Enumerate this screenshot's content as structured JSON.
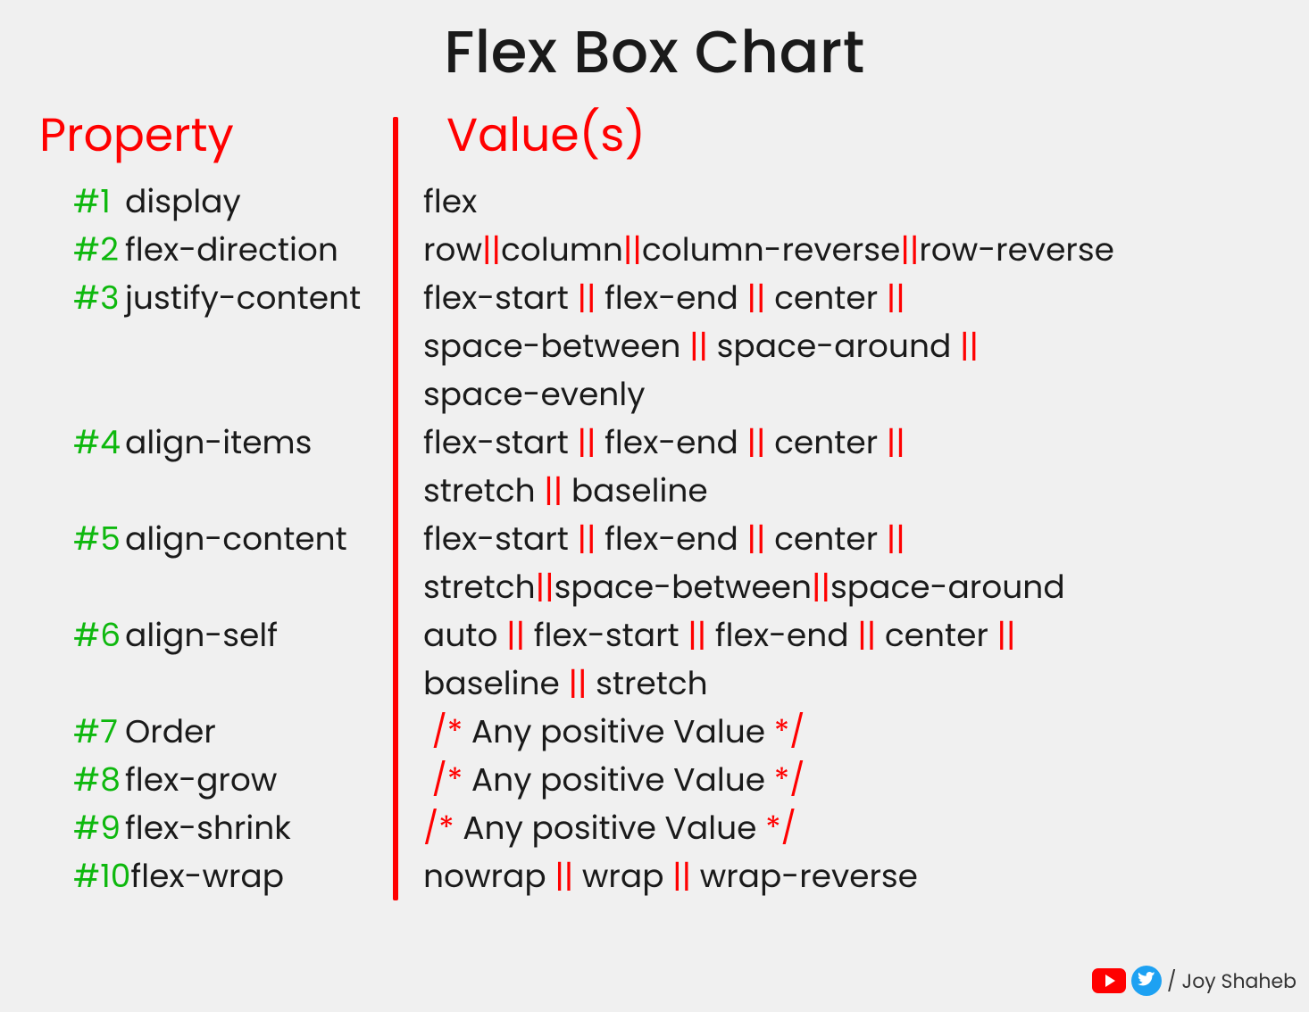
{
  "title": "Flex Box Chart",
  "headers": {
    "property": "Property",
    "values": "Value(s)"
  },
  "separator": "||",
  "rows": [
    {
      "idx": "#1",
      "prop": "display",
      "values": [
        "flex"
      ]
    },
    {
      "idx": "#2",
      "prop": "flex-direction",
      "values": [
        "row",
        "column",
        "column-reverse",
        "row-reverse"
      ]
    },
    {
      "idx": "#3",
      "prop": "justify-content",
      "values": [
        "flex-start",
        "flex-end",
        "center",
        "space-between",
        "space-around",
        "space-evenly"
      ]
    },
    {
      "idx": "#4",
      "prop": "align-items",
      "values": [
        "flex-start",
        "flex-end",
        "center",
        "stretch",
        "baseline"
      ]
    },
    {
      "idx": "#5",
      "prop": "align-content",
      "values": [
        "flex-start",
        "flex-end",
        "center",
        "stretch",
        "space-between",
        "space-around"
      ]
    },
    {
      "idx": "#6",
      "prop": "align-self",
      "values": [
        "auto",
        "flex-start",
        "flex-end",
        "center",
        "baseline",
        "stretch"
      ]
    },
    {
      "idx": "#7",
      "prop": "Order",
      "comment": "Any positive Value"
    },
    {
      "idx": "#8",
      "prop": "flex-grow",
      "comment": "Any positive Value"
    },
    {
      "idx": "#9",
      "prop": "flex-shrink",
      "comment": "Any positive Value"
    },
    {
      "idx": "#10",
      "prop": "flex-wrap",
      "values": [
        "nowrap",
        "wrap",
        "wrap-reverse"
      ]
    }
  ],
  "layout": {
    "value_lines": {
      "1": [
        [
          "row",
          "column",
          "column-reverse",
          "row-reverse"
        ]
      ],
      "2": [
        [
          "flex-start",
          "flex-end",
          "center"
        ],
        [
          "space-between",
          "space-around"
        ],
        [
          "space-evenly"
        ]
      ],
      "3": [
        [
          "flex-start",
          "flex-end",
          "center"
        ],
        [
          "stretch",
          "baseline"
        ]
      ],
      "4": [
        [
          "flex-start",
          "flex-end",
          "center"
        ],
        [
          "stretch",
          "space-between",
          "space-around"
        ]
      ],
      "5": [
        [
          "auto",
          "flex-start",
          "flex-end",
          "center"
        ],
        [
          "baseline",
          "stretch"
        ]
      ],
      "9": [
        [
          "nowrap",
          "wrap",
          "wrap-reverse"
        ]
      ]
    },
    "sep_spacing": {
      "1": "tight",
      "4_line2": "tight"
    }
  },
  "footer": {
    "slash": "/",
    "name": "Joy Shaheb"
  },
  "chart_data": {
    "type": "table",
    "title": "Flex Box Chart",
    "columns": [
      "Property",
      "Value(s)"
    ],
    "rows": [
      [
        "display",
        "flex"
      ],
      [
        "flex-direction",
        "row || column || column-reverse || row-reverse"
      ],
      [
        "justify-content",
        "flex-start || flex-end || center || space-between || space-around || space-evenly"
      ],
      [
        "align-items",
        "flex-start || flex-end || center || stretch || baseline"
      ],
      [
        "align-content",
        "flex-start || flex-end || center || stretch || space-between || space-around"
      ],
      [
        "align-self",
        "auto || flex-start || flex-end || center || baseline || stretch"
      ],
      [
        "Order",
        "/* Any positive Value */"
      ],
      [
        "flex-grow",
        "/* Any positive Value */"
      ],
      [
        "flex-shrink",
        "/* Any positive Value */"
      ],
      [
        "flex-wrap",
        "nowrap || wrap || wrap-reverse"
      ]
    ]
  }
}
